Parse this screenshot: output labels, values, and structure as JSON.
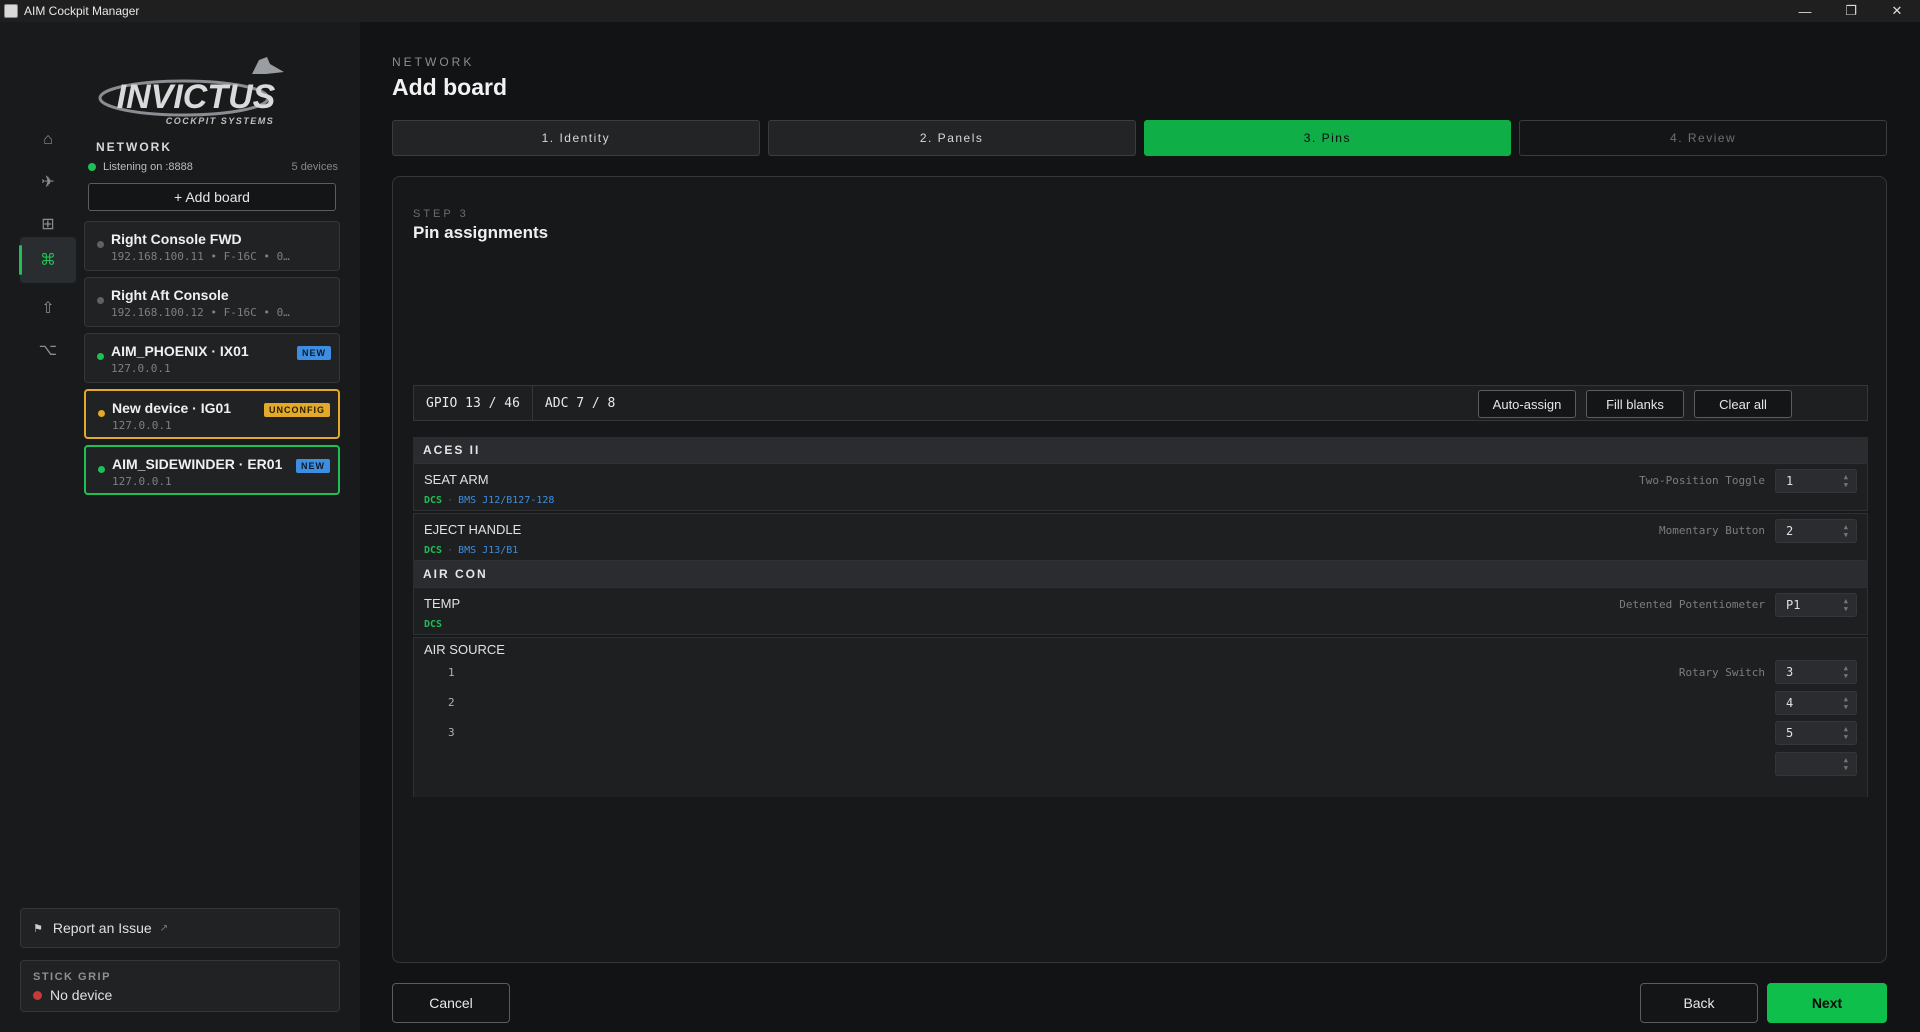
{
  "window": {
    "title": "AIM Cockpit Manager",
    "controls": {
      "minimize": "—",
      "restore": "❐",
      "close": "✕"
    }
  },
  "rail": {
    "items": [
      {
        "icon": "home-icon",
        "glyph": "⌂"
      },
      {
        "icon": "plane-icon",
        "glyph": "✈"
      },
      {
        "icon": "grid-icon",
        "glyph": "⊞"
      },
      {
        "icon": "network-icon",
        "glyph": "⌘",
        "active": true
      },
      {
        "icon": "upload-icon",
        "glyph": "⇧"
      },
      {
        "icon": "branch-icon",
        "glyph": "⌥"
      }
    ]
  },
  "sidebar": {
    "logo": {
      "main": "INVICTUS",
      "sub": "COCKPIT SYSTEMS"
    },
    "section_title": "NETWORK",
    "listening": "Listening on :8888",
    "device_count": "5 devices",
    "add_board": "+ Add board",
    "devices": [
      {
        "name": "Right Console FWD",
        "sub": "192.168.100.11  •  F-16C  •  0…",
        "status": "offline"
      },
      {
        "name": "Right Aft Console",
        "sub": "192.168.100.12  •  F-16C  •  0…",
        "status": "offline"
      },
      {
        "name": "AIM_PHOENIX · IX01",
        "sub": "127.0.0.1",
        "status": "online",
        "badge": "NEW"
      },
      {
        "name": "New device · IG01",
        "sub": "127.0.0.1",
        "status": "pending",
        "badge": "UNCONFIG"
      },
      {
        "name": "AIM_SIDEWINDER · ER01",
        "sub": "127.0.0.1",
        "status": "online",
        "badge": "NEW",
        "selected": true
      }
    ],
    "report": "Report an Issue",
    "report_ext": "↗",
    "stick_grip": {
      "label": "STICK GRIP",
      "value": "No device"
    }
  },
  "main": {
    "breadcrumb": "NETWORK",
    "title": "Add board",
    "steps": [
      {
        "label": "1. Identity",
        "state": "done"
      },
      {
        "label": "2. Panels",
        "state": "done"
      },
      {
        "label": "3. Pins",
        "state": "active"
      },
      {
        "label": "4. Review",
        "state": "future"
      }
    ],
    "card": {
      "step_label": "STEP 3",
      "title": "Pin assignments",
      "gpio": "GPIO 13 / 46",
      "adc": "ADC 7 / 8",
      "buttons": {
        "auto_assign": "Auto-assign",
        "fill_blanks": "Fill blanks",
        "clear_all": "Clear all"
      },
      "groups": [
        {
          "name": "ACES II",
          "pins": [
            {
              "name": "SEAT ARM",
              "type": "Two-Position Toggle",
              "pin": "1",
              "dcs": "DCS",
              "bms": "BMS J12/B127-128"
            },
            {
              "name": "EJECT HANDLE",
              "type": "Momentary Button",
              "pin": "2",
              "dcs": "DCS",
              "bms": "BMS J13/B1"
            }
          ]
        },
        {
          "name": "AIR CON",
          "pins": [
            {
              "name": "TEMP",
              "type": "Detented Potentiometer",
              "pin": "P1",
              "dcs": "DCS"
            },
            {
              "name": "AIR SOURCE",
              "type": "Rotary Switch",
              "positions": [
                {
                  "label": "1",
                  "pin": "3"
                },
                {
                  "label": "2",
                  "pin": "4"
                },
                {
                  "label": "3",
                  "pin": "5"
                }
              ]
            }
          ]
        }
      ]
    },
    "footer": {
      "cancel": "Cancel",
      "back": "Back",
      "next": "Next"
    }
  },
  "colors": {
    "accent": "#0fbf4c",
    "warning": "#e2a92a",
    "info": "#3d8ee0",
    "error": "#c43a3a"
  }
}
